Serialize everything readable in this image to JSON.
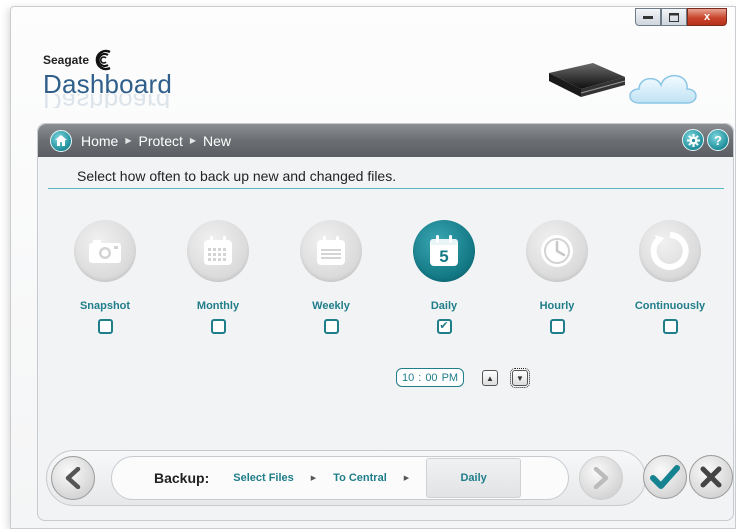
{
  "app": {
    "brand": "Seagate",
    "product": "Dashboard"
  },
  "window_controls": {
    "minimize_icon": "minimize-icon",
    "maximize_icon": "maximize-icon",
    "close_label": "x"
  },
  "breadcrumb": {
    "items": [
      "Home",
      "Protect",
      "New"
    ]
  },
  "instruction": "Select how often to back up new and changed files.",
  "frequencies": [
    {
      "label": "Snapshot",
      "icon": "camera-icon",
      "checked": false
    },
    {
      "label": "Monthly",
      "icon": "calendar-month-icon",
      "checked": false
    },
    {
      "label": "Weekly",
      "icon": "calendar-week-icon",
      "checked": false
    },
    {
      "label": "Daily",
      "icon": "calendar-day-icon",
      "day_number": "5",
      "checked": true
    },
    {
      "label": "Hourly",
      "icon": "clock-icon",
      "checked": false
    },
    {
      "label": "Continuously",
      "icon": "refresh-icon",
      "checked": false
    }
  ],
  "time": {
    "hour": "10",
    "sep": ":",
    "minute": "00",
    "ampm": "PM"
  },
  "wizard": {
    "title": "Backup:",
    "steps": [
      "Select Files",
      "To Central",
      "Daily"
    ],
    "current_step": 2
  },
  "colors": {
    "accent": "#1f7e8a",
    "header_bar": "#6b6e72",
    "brand_blue": "#2f5f8a"
  }
}
